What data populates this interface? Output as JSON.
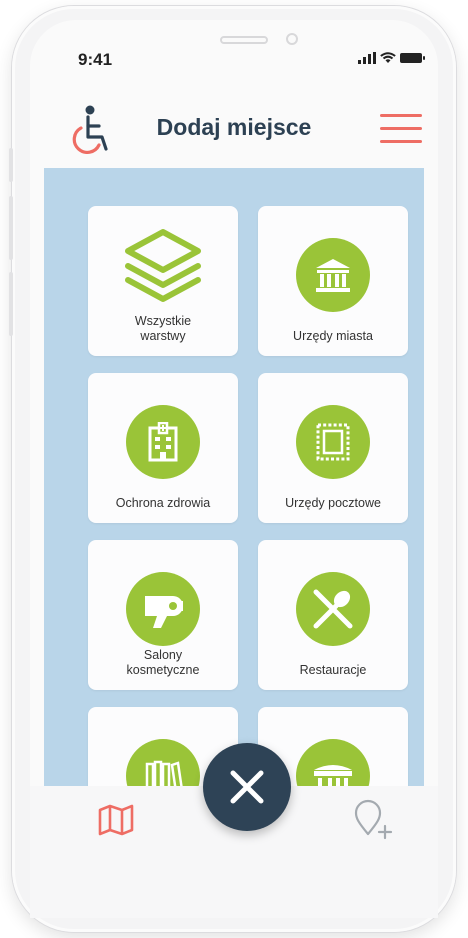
{
  "status_bar": {
    "time": "9:41"
  },
  "header": {
    "title": "Dodaj miejsce"
  },
  "categories": [
    {
      "label": "Wszystkie warstwy",
      "icon": "layers-icon"
    },
    {
      "label": "Urzędy miasta",
      "icon": "city-hall-icon"
    },
    {
      "label": "Ochrona zdrowia",
      "icon": "hospital-icon"
    },
    {
      "label": "Urzędy pocztowe",
      "icon": "stamp-icon"
    },
    {
      "label": "Salony kosmetyczne",
      "icon": "hairdryer-icon"
    },
    {
      "label": "Restauracje",
      "icon": "fork-spoon-icon"
    },
    {
      "label": "",
      "icon": "books-icon"
    },
    {
      "label": "",
      "icon": "market-stall-icon"
    }
  ],
  "bottom_nav": {
    "left_icon": "map-icon",
    "right_icon": "add-pin-icon",
    "center_icon": "close-icon"
  },
  "colors": {
    "accent": "#ee6d64",
    "icon_green": "#9ac438",
    "content_bg": "#b9d5e9",
    "dark_navy": "#2e4356"
  }
}
